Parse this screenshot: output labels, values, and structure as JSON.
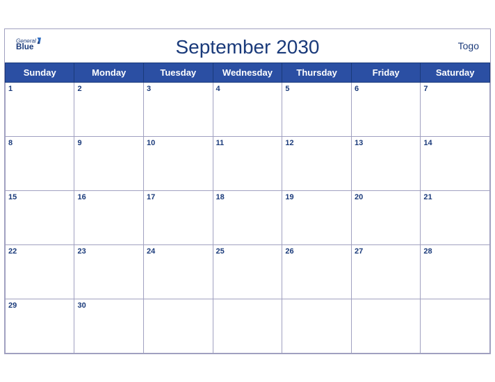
{
  "header": {
    "brand_general": "General",
    "brand_blue": "Blue",
    "title": "September 2030",
    "country": "Togo"
  },
  "weekdays": [
    "Sunday",
    "Monday",
    "Tuesday",
    "Wednesday",
    "Thursday",
    "Friday",
    "Saturday"
  ],
  "weeks": [
    [
      {
        "day": 1
      },
      {
        "day": 2
      },
      {
        "day": 3
      },
      {
        "day": 4
      },
      {
        "day": 5
      },
      {
        "day": 6
      },
      {
        "day": 7
      }
    ],
    [
      {
        "day": 8
      },
      {
        "day": 9
      },
      {
        "day": 10
      },
      {
        "day": 11
      },
      {
        "day": 12
      },
      {
        "day": 13
      },
      {
        "day": 14
      }
    ],
    [
      {
        "day": 15
      },
      {
        "day": 16
      },
      {
        "day": 17
      },
      {
        "day": 18
      },
      {
        "day": 19
      },
      {
        "day": 20
      },
      {
        "day": 21
      }
    ],
    [
      {
        "day": 22
      },
      {
        "day": 23
      },
      {
        "day": 24
      },
      {
        "day": 25
      },
      {
        "day": 26
      },
      {
        "day": 27
      },
      {
        "day": 28
      }
    ],
    [
      {
        "day": 29
      },
      {
        "day": 30
      },
      {
        "day": null
      },
      {
        "day": null
      },
      {
        "day": null
      },
      {
        "day": null
      },
      {
        "day": null
      }
    ]
  ],
  "colors": {
    "header_bg": "#2b4fa3",
    "title_color": "#1a3a7a",
    "row_shade": "#dde5f5"
  }
}
